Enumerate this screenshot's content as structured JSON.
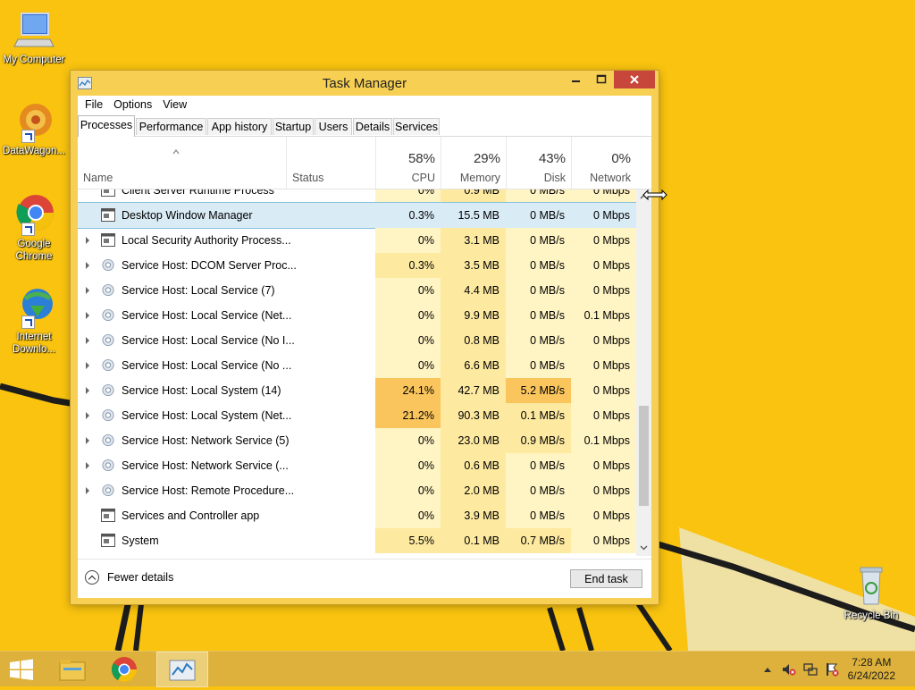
{
  "desktop_icons": [
    {
      "label": "My Computer",
      "icon": "computer-icon"
    },
    {
      "label": "DataWagon...",
      "icon": "datawagon-icon"
    },
    {
      "label": "Google Chrome",
      "icon": "chrome-icon"
    },
    {
      "label": "Internet Downlo...",
      "icon": "idm-icon"
    },
    {
      "label": "Recycle Bin",
      "icon": "recycle-bin-icon"
    }
  ],
  "window": {
    "title": "Task Manager",
    "menu": [
      "File",
      "Options",
      "View"
    ],
    "tabs": [
      "Processes",
      "Performance",
      "App history",
      "Startup",
      "Users",
      "Details",
      "Services"
    ],
    "active_tab": "Processes",
    "columns": {
      "name": "Name",
      "status": "Status",
      "cpu": {
        "pct": "58%",
        "label": "CPU"
      },
      "memory": {
        "pct": "29%",
        "label": "Memory"
      },
      "disk": {
        "pct": "43%",
        "label": "Disk"
      },
      "network": {
        "pct": "0%",
        "label": "Network"
      }
    },
    "partial_row": {
      "name": "Client Server Runtime Process",
      "cpu": "0%",
      "memory": "0.9 MB",
      "disk": "0 MB/s",
      "network": "0 Mbps"
    },
    "rows": [
      {
        "name": "Desktop Window Manager",
        "expandable": false,
        "icon": "window-icon",
        "cpu": "0.3%",
        "memory": "15.5 MB",
        "disk": "0 MB/s",
        "network": "0 Mbps",
        "selected": true
      },
      {
        "name": "Local Security Authority Process...",
        "expandable": true,
        "icon": "window-icon",
        "cpu": "0%",
        "memory": "3.1 MB",
        "disk": "0 MB/s",
        "network": "0 Mbps"
      },
      {
        "name": "Service Host: DCOM Server Proc...",
        "expandable": true,
        "icon": "gear-icon",
        "cpu": "0.3%",
        "memory": "3.5 MB",
        "disk": "0 MB/s",
        "network": "0 Mbps"
      },
      {
        "name": "Service Host: Local Service (7)",
        "expandable": true,
        "icon": "gear-icon",
        "cpu": "0%",
        "memory": "4.4 MB",
        "disk": "0 MB/s",
        "network": "0 Mbps"
      },
      {
        "name": "Service Host: Local Service (Net...",
        "expandable": true,
        "icon": "gear-icon",
        "cpu": "0%",
        "memory": "9.9 MB",
        "disk": "0 MB/s",
        "network": "0.1 Mbps"
      },
      {
        "name": "Service Host: Local Service (No I...",
        "expandable": true,
        "icon": "gear-icon",
        "cpu": "0%",
        "memory": "0.8 MB",
        "disk": "0 MB/s",
        "network": "0 Mbps"
      },
      {
        "name": "Service Host: Local Service (No ...",
        "expandable": true,
        "icon": "gear-icon",
        "cpu": "0%",
        "memory": "6.6 MB",
        "disk": "0 MB/s",
        "network": "0 Mbps"
      },
      {
        "name": "Service Host: Local System (14)",
        "expandable": true,
        "icon": "gear-icon",
        "cpu": "24.1%",
        "memory": "42.7 MB",
        "disk": "5.2 MB/s",
        "network": "0 Mbps"
      },
      {
        "name": "Service Host: Local System (Net...",
        "expandable": true,
        "icon": "gear-icon",
        "cpu": "21.2%",
        "memory": "90.3 MB",
        "disk": "0.1 MB/s",
        "network": "0 Mbps"
      },
      {
        "name": "Service Host: Network Service (5)",
        "expandable": true,
        "icon": "gear-icon",
        "cpu": "0%",
        "memory": "23.0 MB",
        "disk": "0.9 MB/s",
        "network": "0.1 Mbps"
      },
      {
        "name": "Service Host: Network Service (...",
        "expandable": true,
        "icon": "gear-icon",
        "cpu": "0%",
        "memory": "0.6 MB",
        "disk": "0 MB/s",
        "network": "0 Mbps"
      },
      {
        "name": "Service Host: Remote Procedure...",
        "expandable": true,
        "icon": "gear-icon",
        "cpu": "0%",
        "memory": "2.0 MB",
        "disk": "0 MB/s",
        "network": "0 Mbps"
      },
      {
        "name": "Services and Controller app",
        "expandable": false,
        "icon": "window-icon",
        "cpu": "0%",
        "memory": "3.9 MB",
        "disk": "0 MB/s",
        "network": "0 Mbps"
      },
      {
        "name": "System",
        "expandable": false,
        "icon": "window-icon",
        "cpu": "5.5%",
        "memory": "0.1 MB",
        "disk": "0.7 MB/s",
        "network": "0 Mbps"
      }
    ],
    "fewer_details": "Fewer details",
    "end_task": "End task"
  },
  "colors": {
    "light": "#fff4c4",
    "medium": "#fde9a0",
    "hot": "#fac55c",
    "selected": "#d9ebf5"
  },
  "taskbar": {
    "apps": [
      "file-explorer-icon",
      "chrome-icon",
      "task-manager-icon"
    ],
    "time": "7:28 AM",
    "date": "6/24/2022"
  }
}
